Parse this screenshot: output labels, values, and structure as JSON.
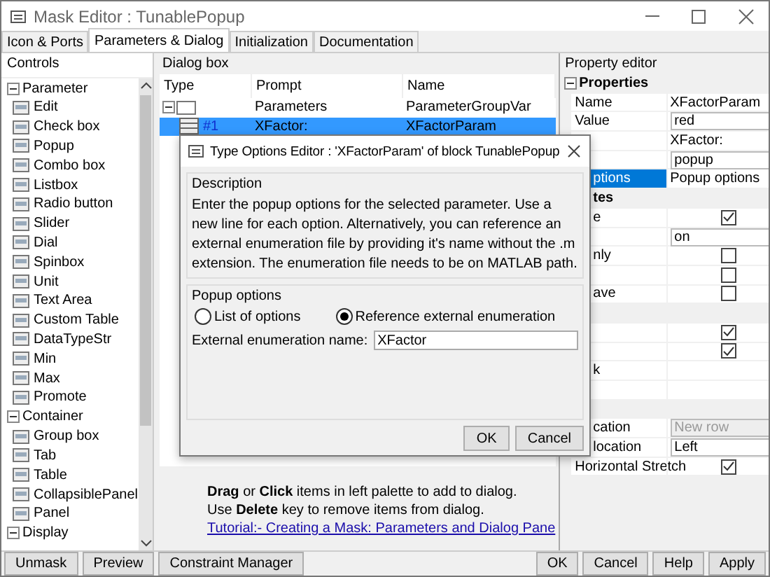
{
  "window": {
    "title": "Mask Editor : TunablePopup"
  },
  "tabs": [
    {
      "label": "Icon & Ports",
      "selected": false
    },
    {
      "label": "Parameters & Dialog",
      "selected": true
    },
    {
      "label": "Initialization",
      "selected": false
    },
    {
      "label": "Documentation",
      "selected": false
    }
  ],
  "palette": {
    "title": "Controls",
    "groups": [
      {
        "label": "Parameter",
        "expanded": true,
        "items": [
          "Edit",
          "Check box",
          "Popup",
          "Combo box",
          "Listbox",
          "Radio button",
          "Slider",
          "Dial",
          "Spinbox",
          "Unit",
          "Text Area",
          "Custom Table",
          "DataTypeStr",
          "Min",
          "Max",
          "Promote"
        ]
      },
      {
        "label": "Container",
        "expanded": true,
        "items": [
          "Group box",
          "Tab",
          "Table",
          "CollapsiblePanel",
          "Panel"
        ]
      },
      {
        "label": "Display",
        "expanded": true
      }
    ]
  },
  "dialog_box": {
    "title": "Dialog box",
    "columns": [
      "Type",
      "Prompt",
      "Name"
    ],
    "rows": [
      {
        "prompt": "Parameters",
        "name": "ParameterGroupVar",
        "expanded": true,
        "selected": false
      },
      {
        "type": "#1",
        "prompt": "XFactor:",
        "name": "XFactorParam",
        "selected": true
      }
    ],
    "hints": [
      "**Drag** or **Click** items in left palette to add to dialog.",
      "Use **Delete** key to remove items from dialog."
    ],
    "link": "Tutorial:- Creating a Mask: Parameters and Dialog Pane"
  },
  "property_editor": {
    "title": "Property editor",
    "sections": [
      {
        "title": "Properties",
        "expanded": true,
        "rows": [
          {
            "label": "Name",
            "kind": "text",
            "value": "XFactorParam",
            "selected": false
          },
          {
            "label": "Value",
            "kind": "select",
            "value": "red",
            "disabled": false,
            "selected": false
          },
          {
            "kind": "text",
            "value": "XFactor:",
            "selected": false
          },
          {
            "kind": "select",
            "value": "popup",
            "disabled": false,
            "selected": false
          },
          {
            "label": "ptions",
            "kind": "edit",
            "value": "Popup options",
            "selected": true
          }
        ]
      },
      {
        "title": "tes",
        "rows": [
          {
            "label": "e",
            "kind": "check",
            "checked": true,
            "selected": false
          },
          {
            "kind": "select",
            "value": "on",
            "disabled": false,
            "selected": false
          },
          {
            "label": "nly",
            "kind": "check",
            "checked": false,
            "selected": false
          },
          {
            "kind": "check",
            "checked": false,
            "selected": false
          },
          {
            "label": "ave",
            "kind": "check",
            "checked": false,
            "selected": false
          }
        ]
      },
      {
        "rows": [
          {
            "kind": "check",
            "checked": true,
            "selected": false
          },
          {
            "kind": "check",
            "checked": true,
            "selected": false
          },
          {
            "label": "k",
            "kind": "edit",
            "selected": false
          },
          {
            "kind": "text",
            "selected": false
          }
        ]
      },
      {
        "rows": [
          {
            "label": "cation",
            "kind": "select",
            "value": "New row",
            "disabled": true,
            "selected": false
          },
          {
            "label": "location",
            "kind": "select",
            "value": "Left",
            "disabled": false,
            "selected": false
          },
          {
            "label": "Horizontal Stretch",
            "kind": "check",
            "checked": true,
            "selected": false
          }
        ]
      }
    ]
  },
  "footer": {
    "left_buttons": [
      "Unmask",
      "Preview",
      "Constraint Manager"
    ],
    "right_buttons": [
      "OK",
      "Cancel",
      "Help",
      "Apply"
    ]
  },
  "options_dialog": {
    "title": "Type Options Editor : 'XFactorParam' of block TunablePopup",
    "description_title": "Description",
    "description": "Enter the popup options for the selected parameter. Use a new line for each option. Alternatively, you can reference an external enumeration file by providing it's name without the .m extension. The enumeration file needs to be on MATLAB path.",
    "options_title": "Popup options",
    "radios": [
      {
        "label": "List of options",
        "selected": false
      },
      {
        "label": "Reference external enumeration",
        "selected": true
      }
    ],
    "field_label": "External enumeration name:",
    "field_value": "XFactor",
    "buttons": [
      "OK",
      "Cancel"
    ]
  }
}
